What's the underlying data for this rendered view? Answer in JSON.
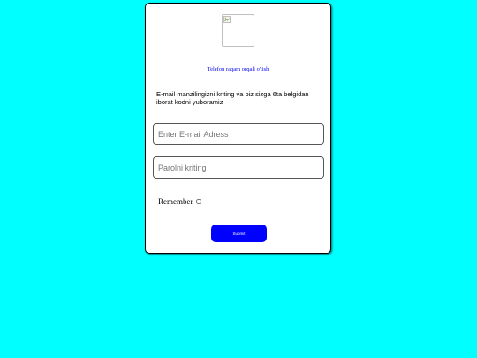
{
  "logo": {
    "icon": "broken-image-icon"
  },
  "phone_login_link": "Telefon raqam orqali o'tish",
  "info_text": "E-mail manzilingizni kriting va biz sizga 6ta belgidan iborat kodni yuboramiz",
  "email": {
    "placeholder": "Enter E-mail Adress",
    "value": ""
  },
  "password": {
    "placeholder": "Parolni kriting",
    "value": ""
  },
  "remember": {
    "label": "Remember",
    "checked": false
  },
  "submit": {
    "label": "Submit"
  },
  "colors": {
    "background": "#00ffff",
    "card": "#ffffff",
    "submit_button": "#0000ff",
    "link": "#0000ee"
  }
}
